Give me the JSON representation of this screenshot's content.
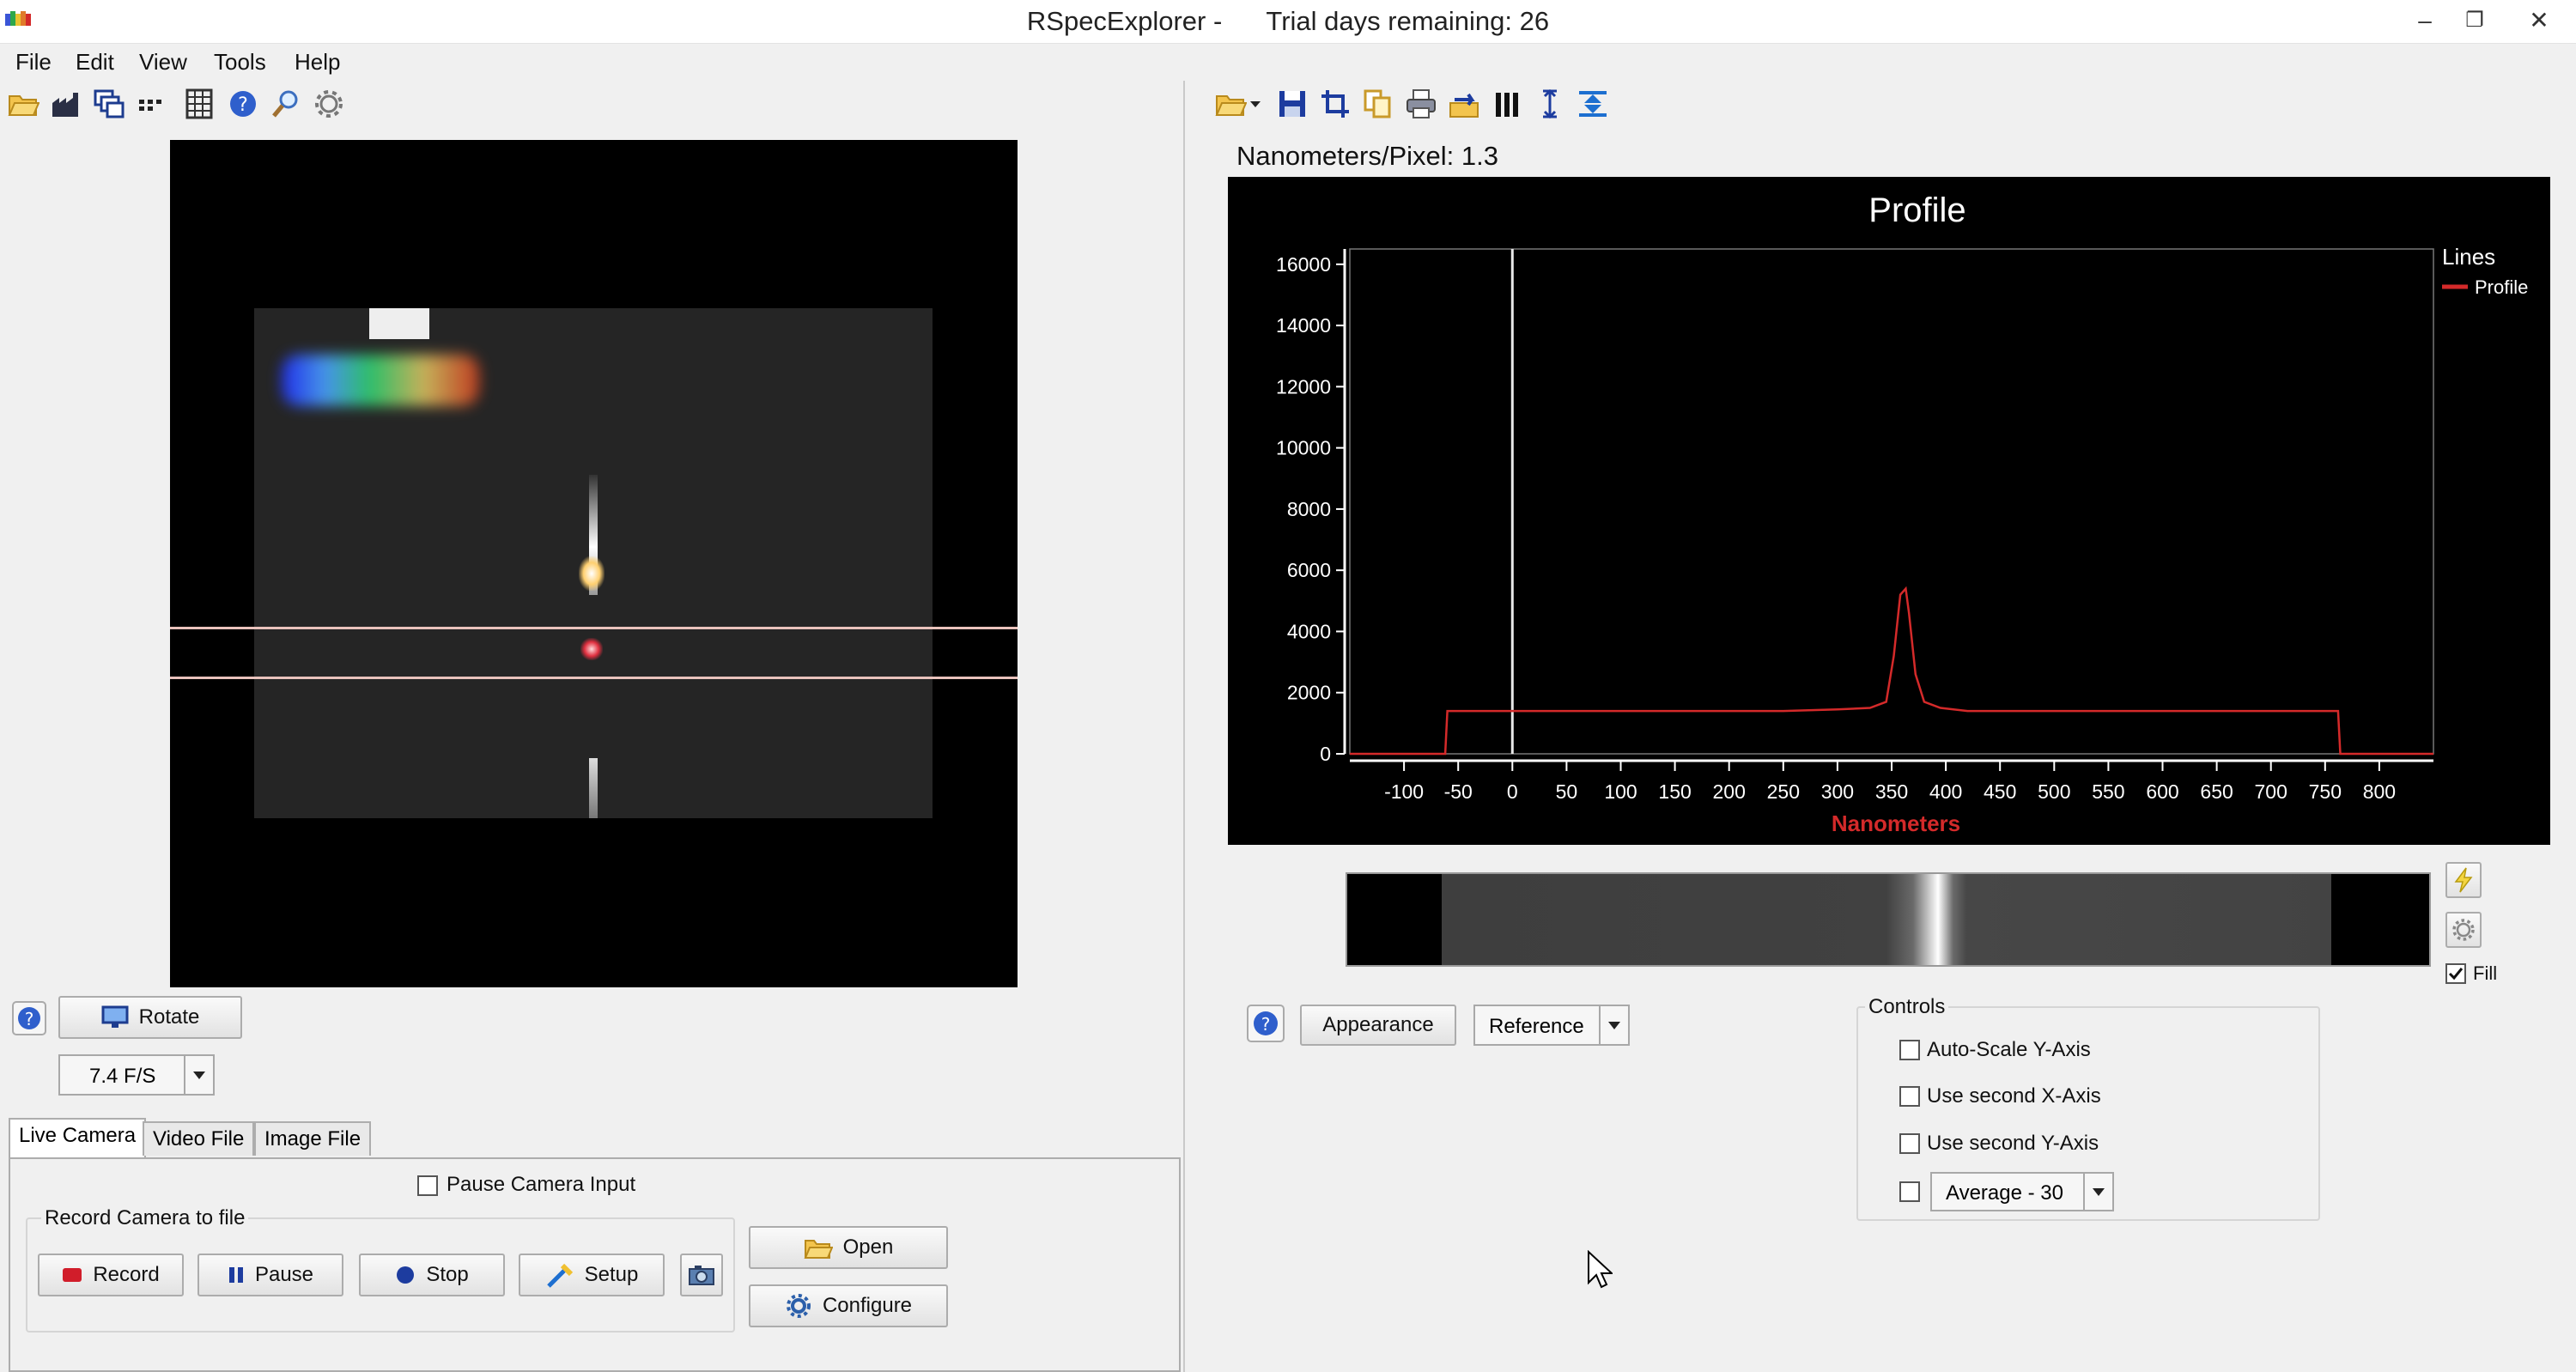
{
  "window": {
    "title": "RSpecExplorer -      Trial days remaining: 26",
    "minimize": "–",
    "restore": "❐",
    "close": "✕"
  },
  "menu": [
    "File",
    "Edit",
    "View",
    "Tools",
    "Help"
  ],
  "left_toolbar_icons": [
    "open-folder-icon",
    "factory-icon",
    "copy-windows-icon",
    "dots-icon",
    "grid-icon",
    "help-icon",
    "zoom-icon",
    "settings-gear-icon"
  ],
  "right_toolbar_icons": [
    "open-folder-icon",
    "dropdown-arrow-icon",
    "save-icon",
    "crop-icon",
    "copy-icon",
    "print-icon",
    "export-icon",
    "bars-icon",
    "vertical-arrows-icon",
    "up-down-icon"
  ],
  "left": {
    "rotate_label": "Rotate",
    "fps_value": "7.4 F/S",
    "tabs": [
      "Live Camera",
      "Video File",
      "Image File"
    ],
    "pause_camera_label": "Pause Camera Input",
    "record_group_label": "Record Camera to file",
    "record_label": "Record",
    "pause_label": "Pause",
    "stop_label": "Stop",
    "setup_label": "Setup",
    "open_label": "Open",
    "configure_label": "Configure"
  },
  "right": {
    "nm_per_pixel": "Nanometers/Pixel: 1.3",
    "appearance_label": "Appearance",
    "reference_label": "Reference",
    "fill_label": "Fill",
    "controls_label": "Controls",
    "auto_scale_label": "Auto-Scale Y-Axis",
    "second_x_label": "Use second X-Axis",
    "second_y_label": "Use second Y-Axis",
    "average_value": "Average - 30"
  },
  "chart_data": {
    "type": "line",
    "title": "Profile",
    "xlabel": "Nanometers",
    "ylabel": "",
    "xlim": [
      -150,
      850
    ],
    "ylim": [
      0,
      16500
    ],
    "xticks": [
      -100,
      -50,
      0,
      50,
      100,
      150,
      200,
      250,
      300,
      350,
      400,
      450,
      500,
      550,
      600,
      650,
      700,
      750,
      800
    ],
    "yticks": [
      0,
      2000,
      4000,
      6000,
      8000,
      10000,
      12000,
      14000,
      16000
    ],
    "legend_title": "Lines",
    "legend_position": "top-right",
    "series": [
      {
        "name": "Profile",
        "color": "#d42a2a",
        "x": [
          -150,
          -62,
          -60,
          250,
          300,
          330,
          345,
          352,
          358,
          363,
          366,
          372,
          380,
          395,
          420,
          450,
          500,
          600,
          700,
          762,
          764,
          850
        ],
        "y": [
          0,
          0,
          1400,
          1400,
          1450,
          1500,
          1700,
          3200,
          5200,
          5400,
          4600,
          2600,
          1700,
          1500,
          1400,
          1400,
          1400,
          1400,
          1400,
          1400,
          0,
          0
        ]
      }
    ],
    "reference_line_x": 0
  },
  "colors": {
    "chart_bg": "#000000",
    "series": "#d42a2a",
    "xlabel": "#d42a2a",
    "crosshair": "#e8e8e8"
  }
}
